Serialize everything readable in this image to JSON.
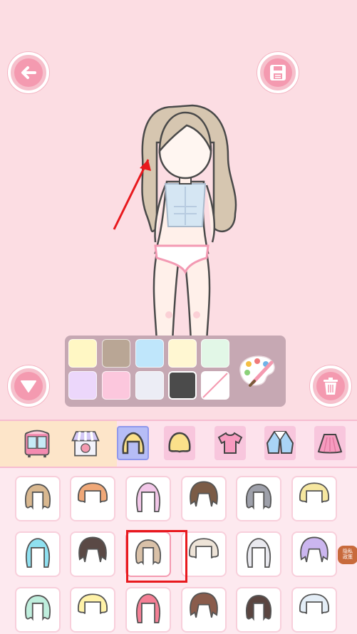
{
  "colors": {
    "background": "#fcdde3",
    "button_ring": "#f6c0cc",
    "button_fill": "#f49ab0",
    "palette_panel": "#c6a8b3",
    "annotation": "#e8191e"
  },
  "top_bar": {
    "back_icon": "back-arrow-icon",
    "save_icon": "floppy-save-icon"
  },
  "side_buttons": {
    "collapse_icon": "triangle-down-icon",
    "delete_icon": "trash-icon"
  },
  "palette": {
    "swatches": [
      "#fff7c4",
      "#b9a695",
      "#bfe6fb",
      "#fff7d2",
      "#e2f7e7",
      "#ecd7fb",
      "#fcc7dd",
      "#ecedf5",
      "#4b4b4b",
      "none"
    ],
    "selected_index": 8,
    "paint_icon": "paint-palette-icon"
  },
  "tabs": {
    "items": [
      {
        "name": "wardrobe-tab",
        "icon": "wardrobe-icon"
      },
      {
        "name": "shop-tab",
        "icon": "shop-icon"
      },
      {
        "name": "back-hair-tab",
        "icon": "back-hair-icon"
      },
      {
        "name": "front-hair-tab",
        "icon": "front-hair-icon"
      },
      {
        "name": "shirt-tab",
        "icon": "tshirt-icon"
      },
      {
        "name": "jacket-tab",
        "icon": "jacket-icon"
      },
      {
        "name": "skirt-tab",
        "icon": "skirt-icon"
      }
    ],
    "selected_index": 2
  },
  "hair_items": {
    "selected_index": 8,
    "colors": [
      "#d9b890",
      "#f0a878",
      "#f2c7e8",
      "#7b5b46",
      "#9ea0aa",
      "#f6e7a0",
      "#8fe0f0",
      "#5a4945",
      "#d9c1a8",
      "#eee4d8",
      "#e9e9ef",
      "#cbb6ef",
      "#bfeedd",
      "#fff2a8",
      "#f47f95",
      "#8a5c4c",
      "#5a4540",
      "#e4eef7"
    ]
  },
  "side_badge": {
    "text": "隐私 政策"
  }
}
